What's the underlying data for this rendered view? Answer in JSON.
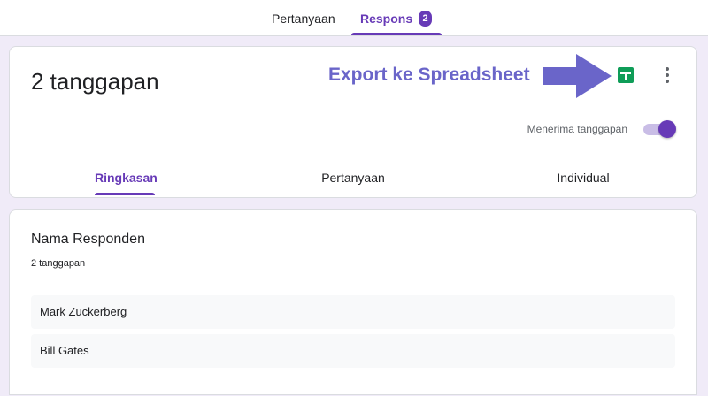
{
  "top_tabs": {
    "questions_label": "Pertanyaan",
    "responses_label": "Respons",
    "responses_count": "2"
  },
  "header": {
    "response_count_text": "2 tanggapan",
    "annotation": "Export ke Spreadsheet",
    "accepting_label": "Menerima tanggapan",
    "accepting_responses": true,
    "sheets_icon": "google-sheets-icon",
    "more_icon": "more-vert-icon"
  },
  "sub_tabs": [
    {
      "label": "Ringkasan",
      "active": true
    },
    {
      "label": "Pertanyaan",
      "active": false
    },
    {
      "label": "Individual",
      "active": false
    }
  ],
  "question": {
    "title": "Nama Responden",
    "count_text": "2 tanggapan",
    "answers": [
      "Mark Zuckerberg",
      "Bill Gates"
    ]
  },
  "colors": {
    "accent": "#673ab7",
    "background": "#f0ebf8",
    "annotation": "#6a65c9",
    "sheets_green": "#0f9d58"
  }
}
